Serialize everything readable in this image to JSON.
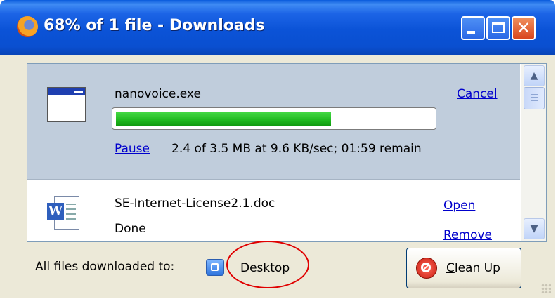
{
  "window": {
    "title": "68% of 1 file - Downloads",
    "controls": [
      "minimize",
      "maximize",
      "close"
    ]
  },
  "downloads": [
    {
      "filename": "nanovoice.exe",
      "action_link": "Cancel",
      "control_link": "Pause",
      "progress_fraction": 0.68,
      "status": "2.4 of 3.5 MB at 9.6 KB/sec; 01:59 remain",
      "icon": "application-window-icon"
    },
    {
      "filename": "SE-Internet-License2.1.doc",
      "status": "Done",
      "open_link": "Open",
      "remove_link": "Remove",
      "icon": "word-document-icon"
    }
  ],
  "footer": {
    "label": "All files downloaded to:",
    "folder": "Desktop",
    "folder_icon": "desktop-folder-icon",
    "cleanup_button": {
      "mnemonic": "C",
      "rest": "lean Up",
      "label": "Clean Up"
    }
  },
  "colors": {
    "titlebar": "#0a4fd0",
    "progress_fill": "#1eb81e",
    "active_row_bg": "#c0cddc",
    "link": "#0000cc",
    "annotation_circle": "#e00000"
  }
}
